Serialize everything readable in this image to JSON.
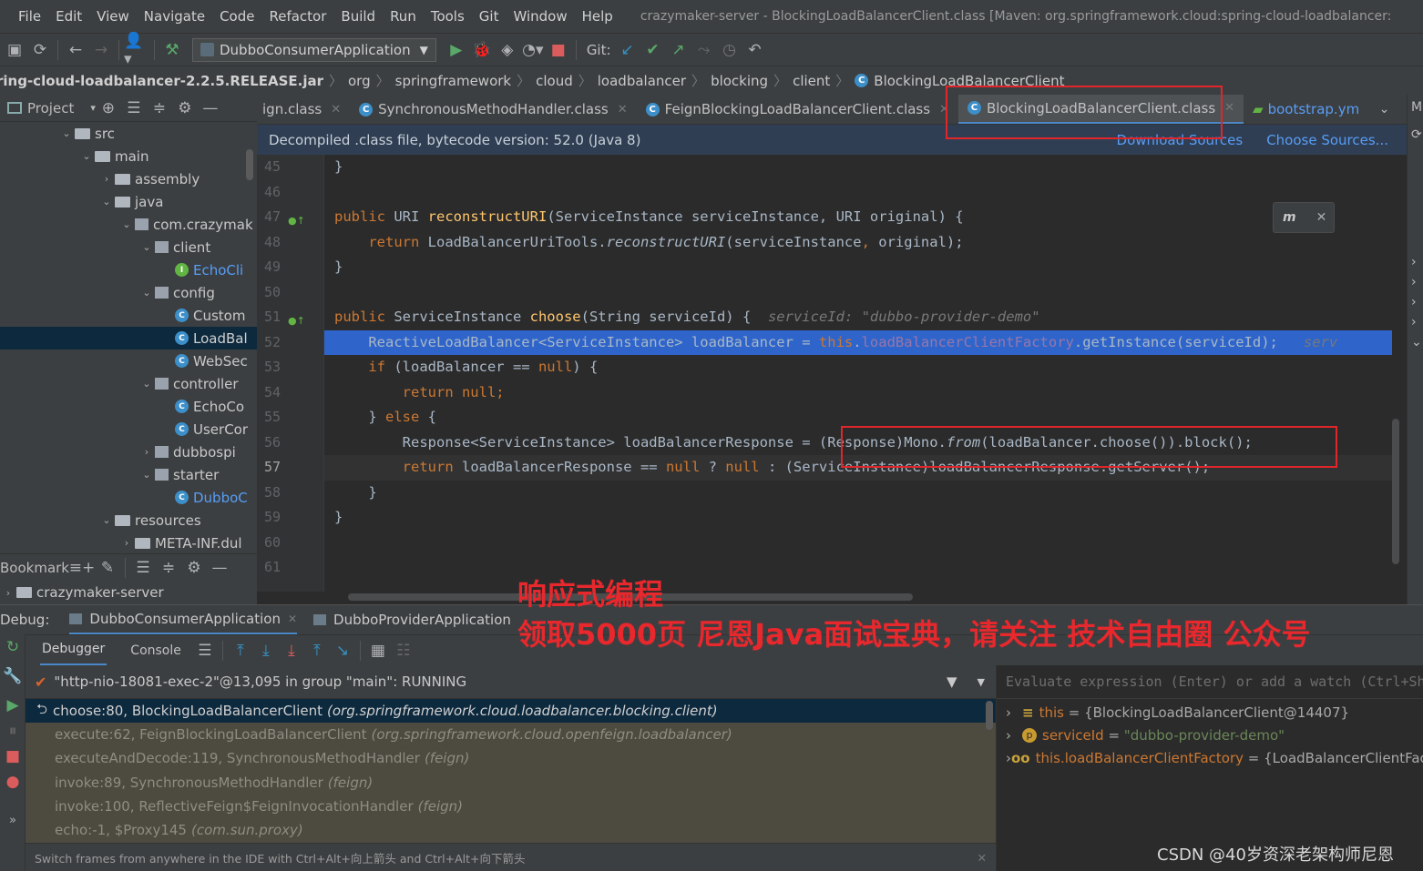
{
  "menu": [
    "File",
    "Edit",
    "View",
    "Navigate",
    "Code",
    "Refactor",
    "Build",
    "Run",
    "Tools",
    "Git",
    "Window",
    "Help"
  ],
  "window_title": "crazymaker-server - BlockingLoadBalancerClient.class [Maven: org.springframework.cloud:spring-cloud-loadbalancer:",
  "toolbar": {
    "run_config": "DubboConsumerApplication",
    "git_label": "Git:"
  },
  "breadcrumb": [
    "ring-cloud-loadbalancer-2.2.5.RELEASE.jar",
    "org",
    "springframework",
    "cloud",
    "loadbalancer",
    "blocking",
    "client",
    "BlockingLoadBalancerClient"
  ],
  "project": {
    "title": "Project",
    "tree": [
      {
        "label": "src",
        "indent": 3,
        "arrow": "⌄",
        "icon": "folder"
      },
      {
        "label": "main",
        "indent": 4,
        "arrow": "⌄",
        "icon": "folder"
      },
      {
        "label": "assembly",
        "indent": 5,
        "arrow": "›",
        "icon": "folder"
      },
      {
        "label": "java",
        "indent": 5,
        "arrow": "⌄",
        "icon": "folder"
      },
      {
        "label": "com.crazymak",
        "indent": 6,
        "arrow": "⌄",
        "icon": "pkg"
      },
      {
        "label": "client",
        "indent": 7,
        "arrow": "⌄",
        "icon": "pkg"
      },
      {
        "label": "EchoCli",
        "indent": 8,
        "arrow": "",
        "icon": "iface",
        "blue": true
      },
      {
        "label": "config",
        "indent": 7,
        "arrow": "⌄",
        "icon": "pkg"
      },
      {
        "label": "Custom",
        "indent": 8,
        "arrow": "",
        "icon": "class"
      },
      {
        "label": "LoadBal",
        "indent": 8,
        "arrow": "",
        "icon": "class",
        "selected": true,
        "blue": true
      },
      {
        "label": "WebSec",
        "indent": 8,
        "arrow": "",
        "icon": "class"
      },
      {
        "label": "controller",
        "indent": 7,
        "arrow": "⌄",
        "icon": "pkg"
      },
      {
        "label": "EchoCo",
        "indent": 8,
        "arrow": "",
        "icon": "class"
      },
      {
        "label": "UserCor",
        "indent": 8,
        "arrow": "",
        "icon": "class"
      },
      {
        "label": "dubbospi",
        "indent": 7,
        "arrow": "›",
        "icon": "pkg"
      },
      {
        "label": "starter",
        "indent": 7,
        "arrow": "⌄",
        "icon": "pkg"
      },
      {
        "label": "DubboC",
        "indent": 8,
        "arrow": "",
        "icon": "class",
        "blue": true
      },
      {
        "label": "resources",
        "indent": 5,
        "arrow": "⌄",
        "icon": "folder"
      },
      {
        "label": "META-INF.dul",
        "indent": 6,
        "arrow": "›",
        "icon": "folder"
      }
    ],
    "bookmarks_title": "Bookmark",
    "bookmark_item": "crazymaker-server"
  },
  "tabs": [
    {
      "label": "ign.class"
    },
    {
      "label": "SynchronousMethodHandler.class"
    },
    {
      "label": "FeignBlockingLoadBalancerClient.class"
    },
    {
      "label": "BlockingLoadBalancerClient.class",
      "active": true
    },
    {
      "label": "bootstrap.yml"
    }
  ],
  "infobar": {
    "text": "Decompiled .class file, bytecode version: 52.0 (Java 8)",
    "download": "Download Sources",
    "choose": "Choose Sources..."
  },
  "line_numbers": [
    "45",
    "46",
    "47",
    "48",
    "49",
    "50",
    "51",
    "52",
    "53",
    "54",
    "55",
    "56",
    "57",
    "58",
    "59",
    "60",
    "61"
  ],
  "code": {
    "l45": "}",
    "l47": {
      "kw1": "public ",
      "t1": "URI ",
      "fn": "reconstructURI",
      "t2": "(ServiceInstance serviceInstance, URI original) {"
    },
    "l48": {
      "kw": "return ",
      "t1": "LoadBalancerUriTools.",
      "it": "reconstructURI",
      "t2": "(serviceInstance",
      "comma": ", ",
      "t3": "original);"
    },
    "l49": "}",
    "l51": {
      "kw": "public ",
      "t1": "ServiceInstance ",
      "fn": "choose",
      "t2": "(String serviceId) {  ",
      "hint": "serviceId: \"dubbo-provider-demo\""
    },
    "l52": {
      "t1": "ReactiveLoadBalancer<ServiceInstance> loadBalancer = ",
      "kw": "this",
      "t2": ".",
      "fld": "loadBalancerClientFactory",
      "t3": ".getInstance(serviceId);   ",
      "hint": "serv"
    },
    "l53": {
      "kw": "if ",
      "t1": "(loadBalancer == ",
      "kw2": "null",
      "t2": ") {"
    },
    "l54": {
      "kw": "return null;"
    },
    "l55": {
      "t1": "} ",
      "kw": "else",
      "t2": " {"
    },
    "l56": {
      "t1": "Response<ServiceInstance> loadBalancerResponse = (Response)Mono.",
      "it": "from",
      "t2": "(loadBalancer.choose()).block();"
    },
    "l57": {
      "kw": "return ",
      "t1": "loadBalancerResponse == ",
      "kw2": "null",
      "t2": " ? ",
      "kw3": "null",
      "t3": " : (ServiceInstance)loadBalancerResponse.getServer();"
    },
    "l58": "}",
    "l59": "}"
  },
  "debug": {
    "label": "Debug:",
    "sessions": [
      "DubboConsumerApplication",
      "DubboProviderApplication"
    ],
    "tabs": [
      "Debugger",
      "Console"
    ],
    "thread": "\"http-nio-18081-exec-2\"@13,095 in group \"main\": RUNNING",
    "frames": [
      {
        "method": "choose:80, BlockingLoadBalancerClient",
        "pkg": "(org.springframework.cloud.loadbalancer.blocking.client)",
        "selected": true
      },
      {
        "method": "execute:62, FeignBlockingLoadBalancerClient",
        "pkg": "(org.springframework.cloud.openfeign.loadbalancer)"
      },
      {
        "method": "executeAndDecode:119, SynchronousMethodHandler",
        "pkg": "(feign)"
      },
      {
        "method": "invoke:89, SynchronousMethodHandler",
        "pkg": "(feign)"
      },
      {
        "method": "invoke:100, ReflectiveFeign$FeignInvocationHandler",
        "pkg": "(feign)"
      },
      {
        "method": "echo:-1, $Proxy145",
        "pkg": "(com.sun.proxy)"
      }
    ],
    "tip": "Switch frames from anywhere in the IDE with Ctrl+Alt+向上箭头 and Ctrl+Alt+向下箭头",
    "eval_placeholder": "Evaluate expression (Enter) or add a watch (Ctrl+Sh",
    "vars": [
      {
        "name": "this",
        "eq": " = ",
        "value": "{BlockingLoadBalancerClient@14407}",
        "icon": "≡",
        "str": false
      },
      {
        "name": "serviceId",
        "eq": " = ",
        "value": "\"dubbo-provider-demo\"",
        "icon": "p",
        "str": true
      },
      {
        "name": "this.loadBalancerClientFactory",
        "eq": " = ",
        "value": "{LoadBalancerClientFact",
        "icon": "oo",
        "str": false
      }
    ]
  },
  "overlay": {
    "line1": "响应式编程",
    "line2": "领取5000页 尼恩Java面试宝典，请关注 技术自由圈 公众号"
  },
  "watermark": "CSDN @40岁资深老架构师尼恩",
  "colors": {
    "accent": "#4a88c7",
    "highlight_red": "#e0262b",
    "selected_line": "#2f65ca"
  }
}
